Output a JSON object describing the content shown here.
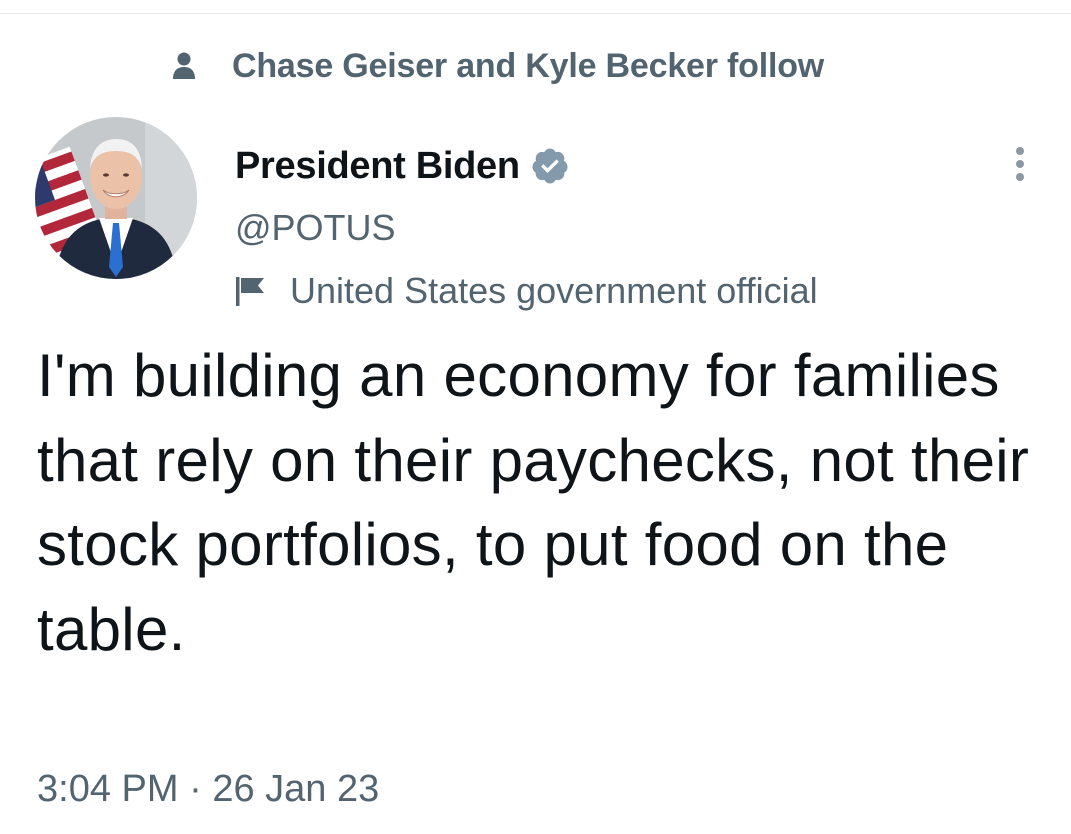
{
  "social_context": {
    "text": "Chase Geiser and Kyle Becker follow",
    "icon": "person-icon"
  },
  "author": {
    "display_name": "President Biden",
    "handle": "@POTUS",
    "verified_icon": "verified-badge-icon",
    "verified_color": "#829aab",
    "label_icon": "flag-icon",
    "label": "United States government official"
  },
  "tweet": {
    "text": "I'm building an economy for families that rely on their paychecks, not their stock portfolios, to put food on the table."
  },
  "meta": {
    "time": "3:04 PM",
    "separator": "·",
    "date": "26 Jan 23"
  },
  "colors": {
    "primary_text": "#0f1419",
    "secondary_text": "#536471"
  }
}
